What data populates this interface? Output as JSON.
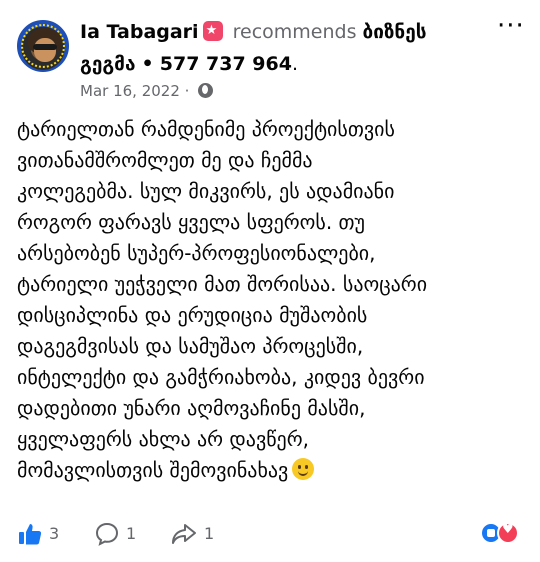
{
  "post": {
    "author": "Ia Tabagari",
    "recommends_text": "recommends",
    "page_name_part1": "ბიზნეს",
    "page_name_part2": "გეგმა",
    "separator": "•",
    "phone": "577 737 964",
    "trailing": ".",
    "date": "Mar 16, 2022",
    "date_sep": "·",
    "body_lines": [
      "ტარიელთან რამდენიმე პროექტისთვის",
      "ვითანამშრომლეთ მე და ჩემმა",
      "კოლეგებმა.  სულ მიკვირს, ეს ადამიანი",
      "როგორ ფარავს ყველა სფეროს. თუ",
      "არსებობენ სუპერ-პროფესიონალები,",
      "ტარიელი უეჭველი მათ შორისაა. საოცარი",
      "დისციპლინა და ერუდიცია მუშაობის",
      "დაგეგმვისას და სამუშაო პროცესში,",
      "ინტელექტი და გამჭრიახობა, კიდევ ბევრი",
      "დადებითი უნარი აღმოვაჩინე მასში,",
      "ყველაფერს ახლა არ დავწერ,",
      "მომავლისთვის შემოვინახავ"
    ]
  },
  "actions": {
    "like_count": "3",
    "comment_count": "1",
    "share_count": "1"
  },
  "icons": {
    "recommend": "recommend-badge-icon",
    "more": "more-options-icon",
    "audience": "globe-icon",
    "like": "thumbs-up-icon",
    "comment": "comment-bubble-icon",
    "share": "share-arrow-icon",
    "emoji": "smiling-face-icon"
  },
  "colors": {
    "accent_blue": "#1877f2",
    "recommend_pink": "#f0466a",
    "muted_gray": "#65676b",
    "love_red": "#f33e58"
  }
}
